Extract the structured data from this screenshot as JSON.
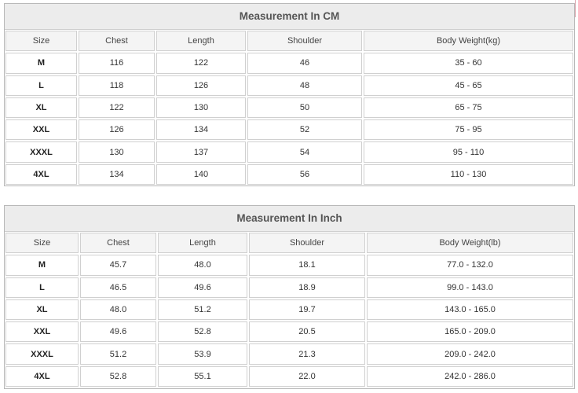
{
  "tables": [
    {
      "title": "Measurement In CM",
      "headers": [
        "Size",
        "Chest",
        "Length",
        "Shoulder",
        "Body Weight(kg)"
      ],
      "rows": [
        [
          "M",
          "116",
          "122",
          "46",
          "35 - 60"
        ],
        [
          "L",
          "118",
          "126",
          "48",
          "45 - 65"
        ],
        [
          "XL",
          "122",
          "130",
          "50",
          "65 - 75"
        ],
        [
          "XXL",
          "126",
          "134",
          "52",
          "75 - 95"
        ],
        [
          "XXXL",
          "130",
          "137",
          "54",
          "95 - 110"
        ],
        [
          "4XL",
          "134",
          "140",
          "56",
          "110 - 130"
        ]
      ]
    },
    {
      "title": "Measurement In Inch",
      "headers": [
        "Size",
        "Chest",
        "Length",
        "Shoulder",
        "Body Weight(lb)"
      ],
      "rows": [
        [
          "M",
          "45.7",
          "48.0",
          "18.1",
          "77.0 - 132.0"
        ],
        [
          "L",
          "46.5",
          "49.6",
          "18.9",
          "99.0 - 143.0"
        ],
        [
          "XL",
          "48.0",
          "51.2",
          "19.7",
          "143.0 - 165.0"
        ],
        [
          "XXL",
          "49.6",
          "52.8",
          "20.5",
          "165.0 - 209.0"
        ],
        [
          "XXXL",
          "51.2",
          "53.9",
          "21.3",
          "209.0 - 242.0"
        ],
        [
          "4XL",
          "52.8",
          "55.1",
          "22.0",
          "242.0 - 286.0"
        ]
      ]
    }
  ]
}
